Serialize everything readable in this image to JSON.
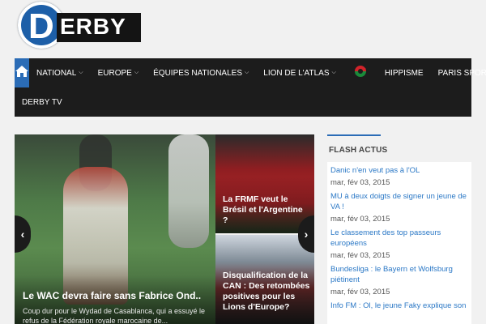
{
  "logo": {
    "text": "ERBY",
    "letter": "D"
  },
  "nav": {
    "row1": [
      {
        "label": "NATIONAL",
        "caret": true
      },
      {
        "label": "EUROPE",
        "caret": true
      },
      {
        "label": "ÉQUIPES NATIONALES",
        "caret": true
      },
      {
        "label": "LION DE L'ATLAS",
        "caret": true
      }
    ],
    "row1_after_icon": [
      {
        "label": "HIPPISME"
      },
      {
        "label": "PARIS SPORTIF"
      }
    ],
    "row2": [
      {
        "label": "DERBY TV"
      }
    ],
    "home_icon": "home-icon",
    "flag_icon": "morocco-algeria-flag-icon"
  },
  "slider": {
    "main": {
      "title": "Le WAC devra faire sans Fabrice Ond..",
      "excerpt": "Coup dur pour le Wydad de Casablanca, qui a essuyé le refus de la Fédération royale marocaine de..."
    },
    "side": [
      {
        "title": "La FRMF veut le Brésil et l'Argentine ?"
      },
      {
        "title": "Disqualification de la CAN : Des retombées positives pour les Lions d'Europe?"
      }
    ],
    "prev_label": "‹",
    "next_label": "›"
  },
  "flash": {
    "title": "FLASH ACTUS",
    "items": [
      {
        "title": "Danic n'en veut pas à l'OL",
        "date": "mar, fév 03, 2015"
      },
      {
        "title": "MU à deux doigts de signer un jeune de VA !",
        "date": "mar, fév 03, 2015"
      },
      {
        "title": "Le classement des top passeurs européens",
        "date": "mar, fév 03, 2015"
      },
      {
        "title": "Bundesliga : le Bayern et Wolfsburg piétinent",
        "date": "mar, fév 03, 2015"
      },
      {
        "title": "Info FM : Ol, le jeune Faky explique son",
        "date": ""
      }
    ]
  },
  "colors": {
    "accent": "#2b6cb6",
    "nav_bg": "#1c1c1c",
    "link": "#2b78c6"
  }
}
